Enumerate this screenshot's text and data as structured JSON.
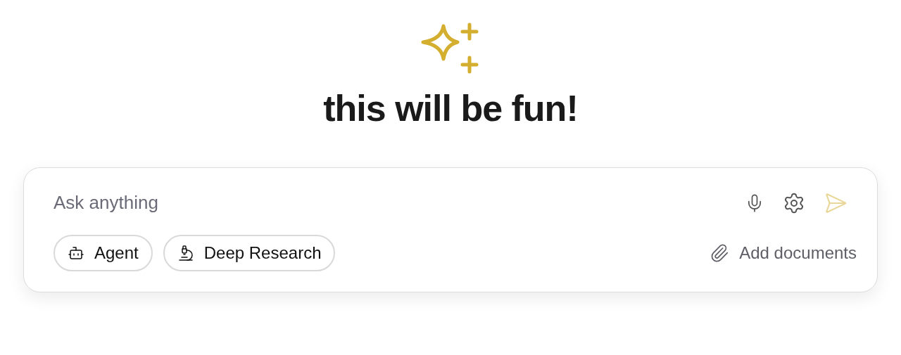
{
  "heading": "this will be fun!",
  "composer": {
    "placeholder": "Ask anything",
    "send_disabled": true,
    "modes": [
      {
        "kind": "agent",
        "label": "Agent"
      },
      {
        "kind": "research",
        "label": "Deep Research"
      }
    ],
    "attach": {
      "label": "Add documents"
    }
  }
}
